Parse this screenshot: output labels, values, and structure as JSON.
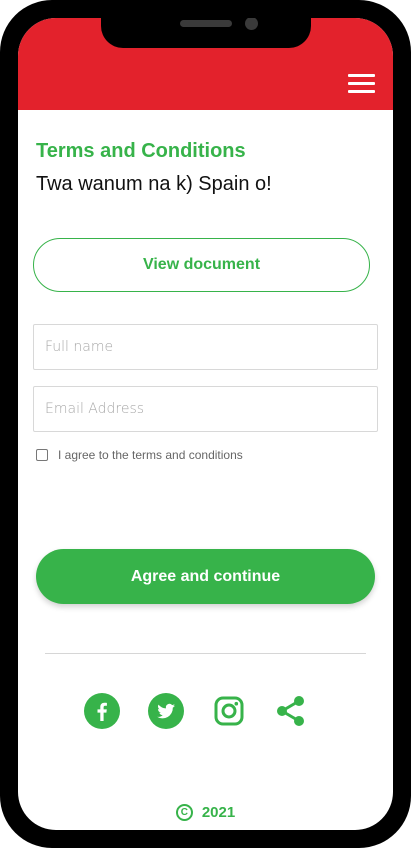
{
  "header": {
    "menu_icon": "hamburger-menu-icon",
    "color": "#e3222c"
  },
  "content": {
    "title": "Terms and Conditions",
    "subtitle": "Twa wanum na k) Spain o!",
    "view_document_label": "View document",
    "full_name_placeholder": "Full name",
    "email_placeholder": "Email Address",
    "agree_label": "I agree to the terms and conditions",
    "agree_checked": false,
    "primary_button_label": "Agree and continue"
  },
  "social": [
    "facebook-icon",
    "twitter-icon",
    "instagram-icon",
    "share-icon"
  ],
  "footer": {
    "copyright_symbol": "C",
    "year": "2021"
  },
  "colors": {
    "accent": "#37b34a",
    "header": "#e3222c"
  }
}
